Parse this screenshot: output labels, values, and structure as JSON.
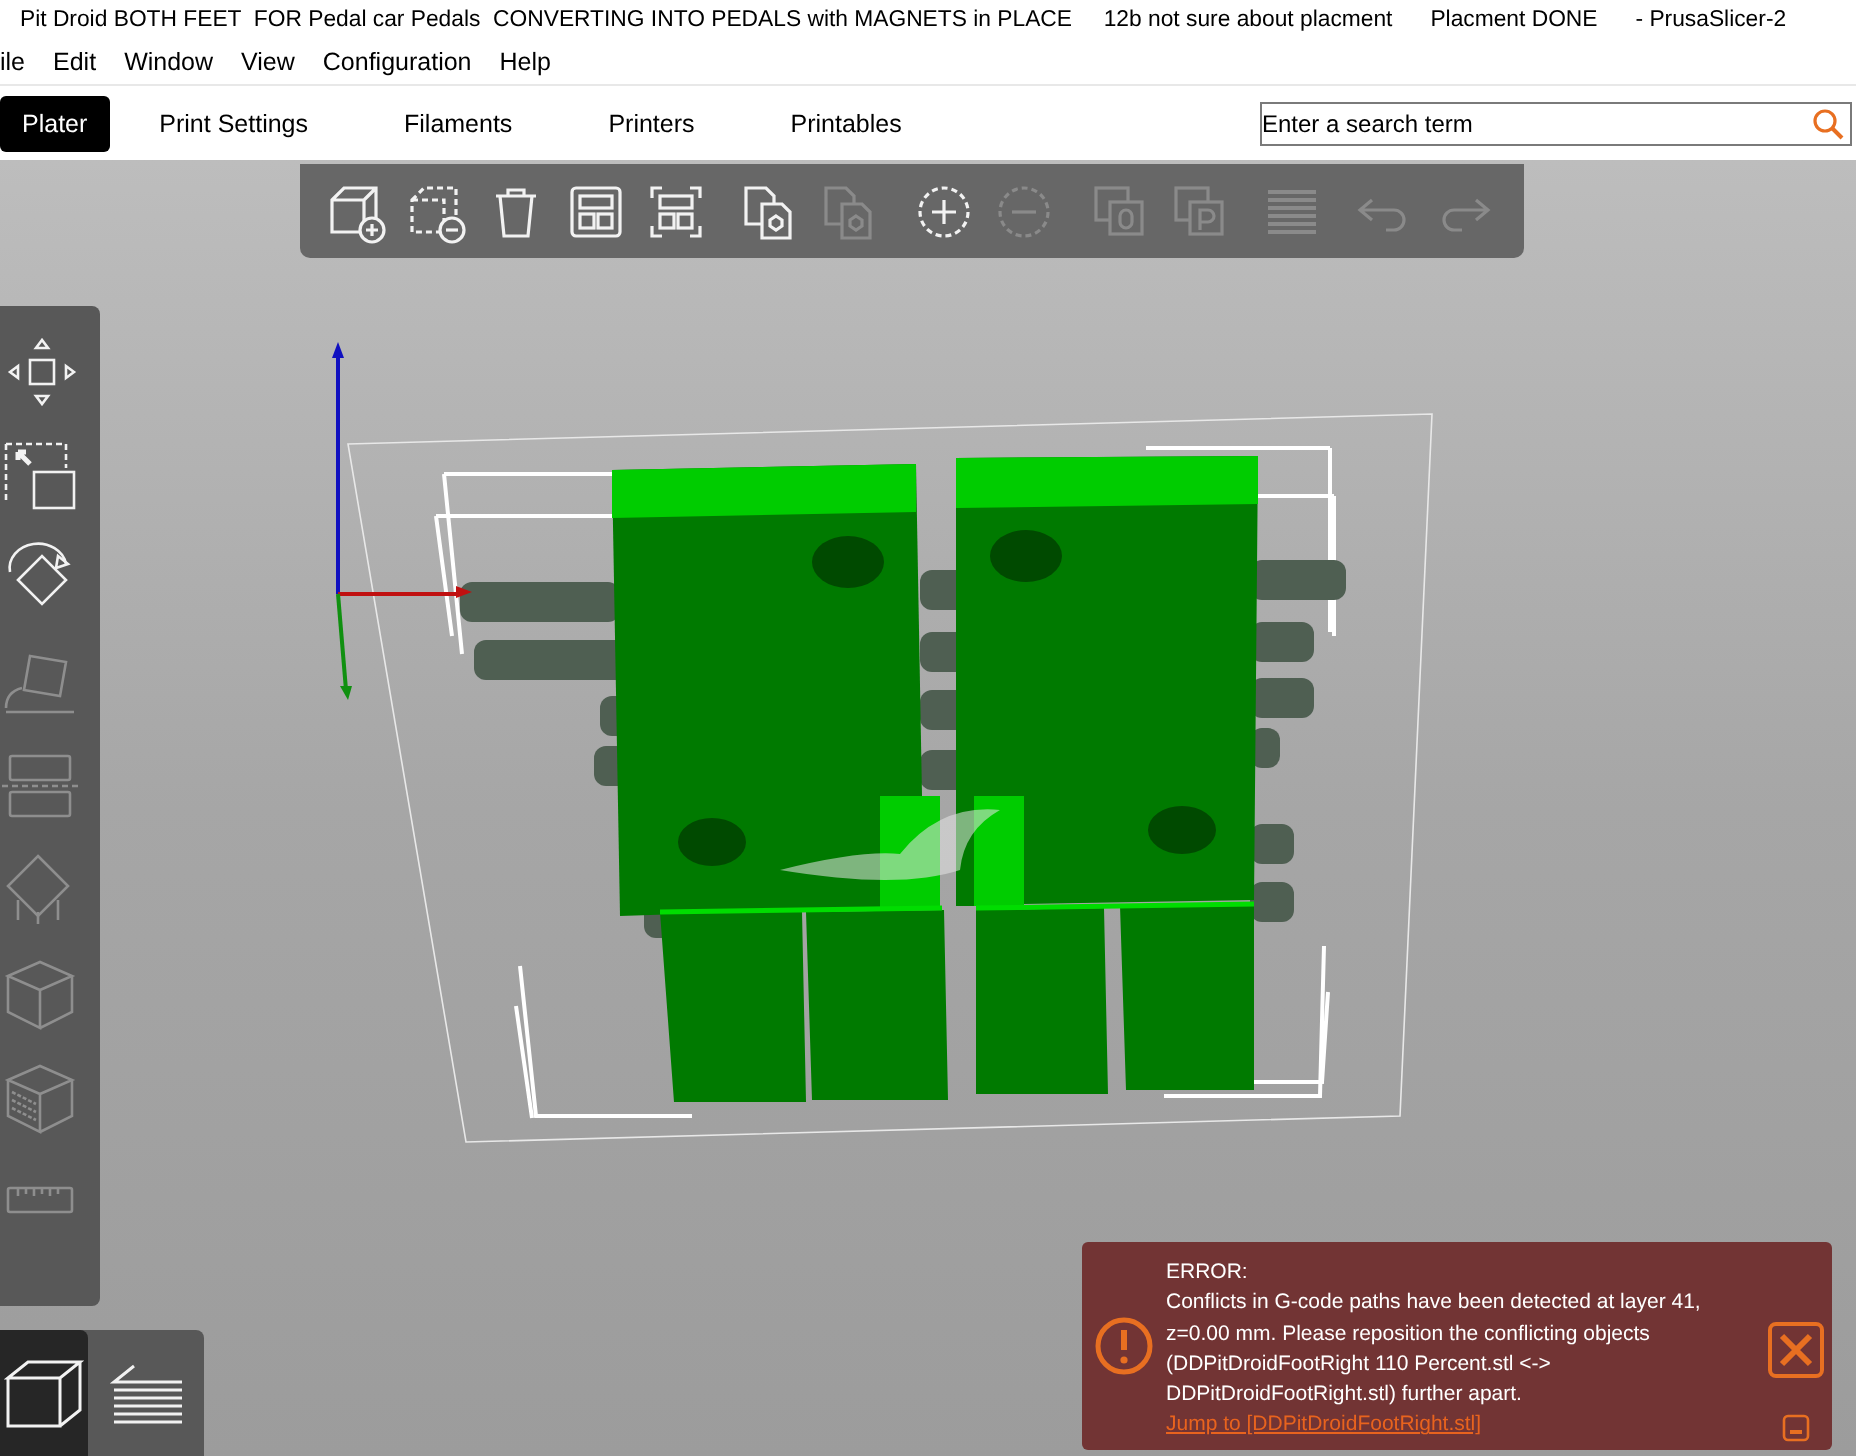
{
  "window": {
    "title": "Pit Droid BOTH FEET  FOR Pedal car Pedals  CONVERTING INTO PEDALS with MAGNETS in PLACE     12b not sure about placment      Placment DONE      - PrusaSlicer-2"
  },
  "menu": [
    "ile",
    "Edit",
    "Window",
    "View",
    "Configuration",
    "Help"
  ],
  "tabs": [
    {
      "label": "Plater",
      "selected": true
    },
    {
      "label": "Print Settings",
      "selected": false
    },
    {
      "label": "Filaments",
      "selected": false
    },
    {
      "label": "Printers",
      "selected": false
    },
    {
      "label": "Printables",
      "selected": false
    }
  ],
  "search": {
    "placeholder": "Enter a search term"
  },
  "toolbar": [
    {
      "kind": "add",
      "disabled": false
    },
    {
      "kind": "delete",
      "disabled": false
    },
    {
      "kind": "delete-all",
      "disabled": false
    },
    {
      "kind": "arrange",
      "disabled": false
    },
    {
      "kind": "arrange-selection",
      "disabled": false
    },
    {
      "kind": "copy",
      "disabled": false
    },
    {
      "kind": "paste",
      "disabled": true
    },
    {
      "kind": "add-instance",
      "disabled": false
    },
    {
      "kind": "remove-instance",
      "disabled": true
    },
    {
      "kind": "split-objects",
      "disabled": true
    },
    {
      "kind": "split-parts",
      "disabled": true
    },
    {
      "kind": "layers",
      "disabled": true
    },
    {
      "kind": "undo",
      "disabled": true
    },
    {
      "kind": "redo",
      "disabled": true
    }
  ],
  "gizmos": [
    {
      "kind": "move",
      "disabled": false
    },
    {
      "kind": "scale",
      "disabled": false
    },
    {
      "kind": "rotate",
      "disabled": false
    },
    {
      "kind": "place",
      "disabled": true
    },
    {
      "kind": "cut",
      "disabled": true
    },
    {
      "kind": "supports",
      "disabled": true
    },
    {
      "kind": "seam",
      "disabled": true
    },
    {
      "kind": "mmu",
      "disabled": true
    },
    {
      "kind": "measure",
      "disabled": true
    }
  ],
  "views": [
    {
      "kind": "model",
      "selected": true
    },
    {
      "kind": "preview",
      "selected": false
    }
  ],
  "notification": {
    "title": "ERROR:",
    "message": "Conflicts in G-code paths have been detected at layer 41, z=0.00 mm. Please reposition the conflicting objects (DDPitDroidFootRight   110 Percent.stl <-> DDPitDroidFootRight.stl) further apart.",
    "link": "Jump to [DDPitDroidFootRight.stl]"
  }
}
